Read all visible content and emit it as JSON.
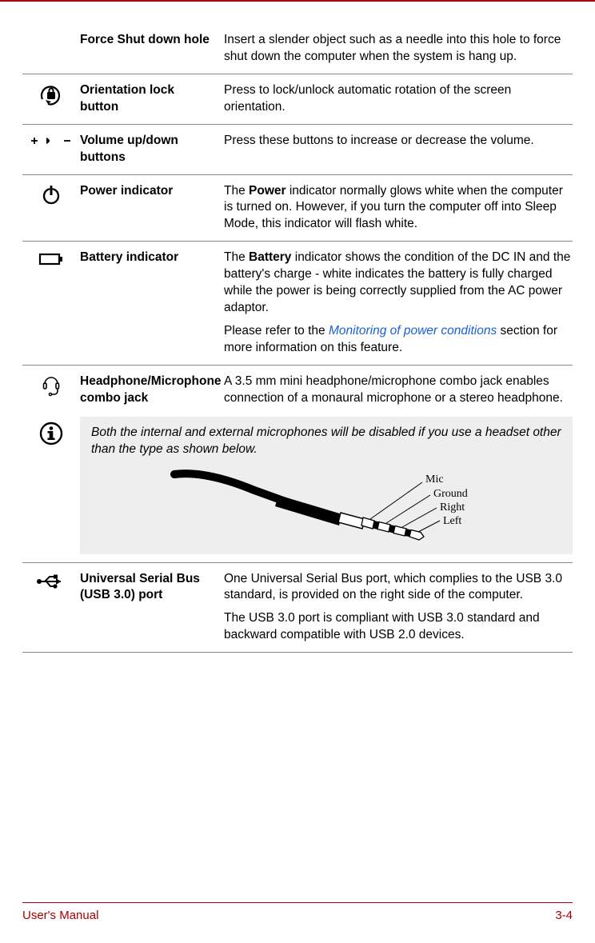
{
  "rows": {
    "force_shutdown": {
      "label": "Force Shut down hole",
      "desc": "Insert a slender object such as a needle into this hole to force shut down the computer when the system is hang up."
    },
    "orientation_lock": {
      "label": "Orientation lock button",
      "desc": "Press to lock/unlock automatic rotation of the screen orientation."
    },
    "volume": {
      "label": "Volume up/down buttons",
      "desc": "Press these buttons to increase or decrease the volume."
    },
    "power_indicator": {
      "label": "Power indicator",
      "desc_pre": "The ",
      "desc_bold": "Power",
      "desc_post": " indicator normally glows white when the computer is turned on. However, if you turn the computer off into Sleep Mode, this indicator will flash white."
    },
    "battery_indicator": {
      "label": "Battery indicator",
      "p1_pre": "The ",
      "p1_bold": "Battery",
      "p1_post": " indicator shows the condition of the DC IN and the battery's charge - white indicates the battery is fully charged while the power is being correctly supplied from the AC power adaptor.",
      "p2_pre": "Please refer to the ",
      "p2_link": "Monitoring of power conditions",
      "p2_post": " section for more information on this feature."
    },
    "headphone": {
      "label": "Headphone/Microphone combo jack",
      "desc": "A 3.5 mm mini headphone/microphone combo jack enables connection of a monaural microphone or a stereo headphone."
    },
    "usb": {
      "label": "Universal Serial Bus (USB 3.0) port",
      "p1": "One Universal Serial Bus port, which complies to the USB 3.0 standard, is provided on the right side of the computer.",
      "p2": "The USB 3.0 port is compliant with USB 3.0 standard and backward compatible with USB 2.0 devices."
    }
  },
  "info_note": {
    "text": "Both the internal and external microphones will be disabled if you use a headset other than the type as shown below.",
    "labels": {
      "mic": "Mic",
      "ground": "Ground",
      "right": "Right",
      "left": "Left"
    }
  },
  "footer": {
    "left": "User's Manual",
    "right": "3-4"
  }
}
